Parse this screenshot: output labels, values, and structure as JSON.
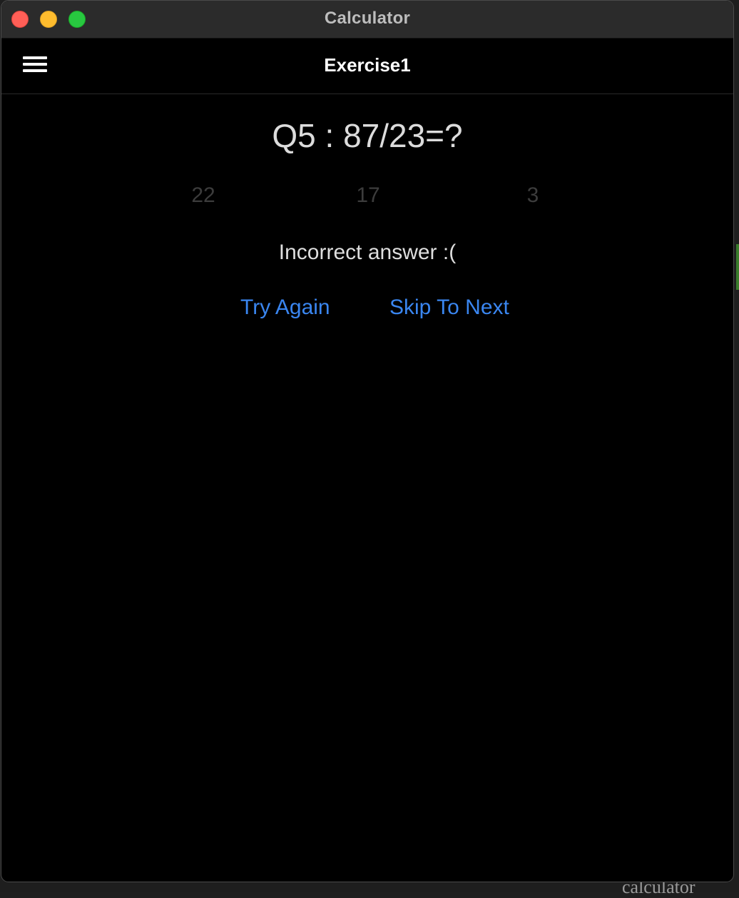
{
  "window": {
    "title": "Calculator"
  },
  "navbar": {
    "title": "Exercise1",
    "menu_icon": "hamburger-menu-icon"
  },
  "exercise": {
    "question": "Q5 : 87/23=?",
    "options": [
      "22",
      "17",
      "3"
    ],
    "feedback": "Incorrect answer :(",
    "try_again_label": "Try Again",
    "skip_label": "Skip To Next"
  },
  "background": {
    "partial_text": "calculator"
  },
  "colors": {
    "accent": "#3a86f0",
    "close": "#ff5f57",
    "minimize": "#febc2e",
    "maximize": "#28c840"
  }
}
